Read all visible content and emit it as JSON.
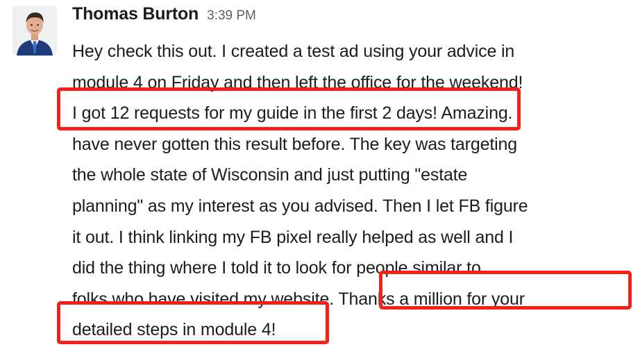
{
  "message": {
    "author": "Thomas Burton",
    "timestamp": "3:39 PM",
    "avatar_icon": "user-avatar-photo",
    "lines": [
      "Hey check this out. I created a test ad using your advice in",
      "module 4 on Friday and then left the office for the weekend!",
      "I got 12 requests for my guide in the first 2 days! Amazing. I",
      "have never gotten this result before. The key was targeting",
      "the whole state of Wisconsin and just putting \"estate",
      "planning\" as my interest as you advised. Then I let FB figure",
      "it out. I think linking my FB pixel really helped as well and I",
      "did the thing where I told it to look for people similar to",
      "folks who have visited my website. Thanks a million for your",
      "detailed steps in module 4!"
    ]
  },
  "highlights": {
    "color": "#f2211a"
  }
}
